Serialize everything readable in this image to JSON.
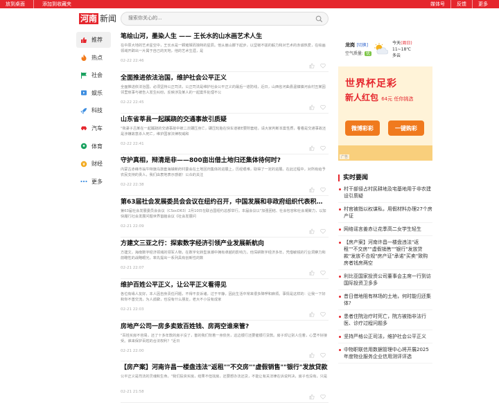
{
  "topbar": {
    "left": [
      "放到桌面",
      "添加到收藏夹"
    ],
    "right": [
      "媒体号",
      "反馈",
      "更多"
    ]
  },
  "header": {
    "logo_box": "河南",
    "logo_text": "新闻",
    "search_placeholder": "搜索你关心的..."
  },
  "nav": [
    {
      "label": "推荐",
      "icon": "thumb-up-icon",
      "color": "#e5262d",
      "active": true
    },
    {
      "label": "热点",
      "icon": "flame-icon",
      "color": "#f27a1a"
    },
    {
      "label": "社会",
      "icon": "flag-icon",
      "color": "#1aa260"
    },
    {
      "label": "娱乐",
      "icon": "film-icon",
      "color": "#3c8de0"
    },
    {
      "label": "科技",
      "icon": "rocket-icon",
      "color": "#3c8de0"
    },
    {
      "label": "汽车",
      "icon": "car-icon",
      "color": "#e5262d"
    },
    {
      "label": "体育",
      "icon": "soccer-icon",
      "color": "#1aa260"
    },
    {
      "label": "财经",
      "icon": "coin-icon",
      "color": "#f2a81a"
    },
    {
      "label": "更多",
      "icon": "more-dots-icon",
      "color": "#3c8de0"
    }
  ],
  "articles": [
    {
      "title": "笔绘山河，墨染人生 —— 王长水的山水画艺术人生",
      "summary": "在中原大地的艺术星空中，王长水是一颗璀璨而独特的星辰。他从嵩山脚下起步，以坚韧不拔的毅力和对艺术的赤诚热爱，在绘画领域开辟出一片属于自己的天地，他的艺术生涯，是",
      "date": "02-22 22:46"
    },
    {
      "title": "全面推进依法治国，维护社会公平正义",
      "summary": "全面推进依法治国，必须坚持公正司法，公正司法是维护社会公平正义的最后一道防线，近日，山西省河曲县温镇镇河会村丑某因邻里琐事与被告人发生纠纷，反映涉及某人的一起案件处理不公",
      "date": "02-22 22:45"
    },
    {
      "title": "山东省莘县一起蹊跷的交通事故引质疑",
      "summary": "\"我妻子吕某在一起蹊跷的交通事故中被二次碾压身亡，碾压轮胎在快车道被E要附套结，请大家判断本案性质，看看是交通事故还是涉嫌故意杀人死亡，维护国家法律权威和",
      "date": "02-22 22:41"
    },
    {
      "title": "守护真相，辩清是非——800亩出借土地归还集体待何时?",
      "summary": "内蒙古赤峰市翁牛特旗乌敦套海镇新府村委会在土地回归集体的进展上，历经艰难，取得了一定的进展。在此过程中，对所有给予农民支持的贵人，我们由衷地表示感谢！公众的关注",
      "date": "02-22 22:38"
    },
    {
      "title": "第63届社会发展委员会会议在纽约召开，中国发展和非政府组织代表积极参与",
      "summary": "第63届社会发展委员会会议（CSocD63）2月10日在联合国纽约总部举行。本届会议以\"加强团结、社会包容和社会凝聚力，以加快履行社会发展问题世界首脑会议《社会发展问",
      "date": "02-21 22:09"
    },
    {
      "title": "方建文三亚之行：探索数字经济引领产业发展新航向",
      "summary": "方建文，海南数字经济领域的领军人物，在数字化转型浪潮中拥有卓越的影响力。他深耕数字经济多年，凭借敏锐的行业洞察力和前瞻性的战略眼光，率先提出一系列具有创新性的数",
      "date": "02-21 22:07"
    },
    {
      "title": "维护百姓公平正义，让公平正义看得见",
      "summary": "各位有缘人友好，本人因自身责任问题，不得不去诉诸，过于平静，因此生活中常来很多降啰和麻烦。事情是这样的：让我一下好和你不善交流，为人孤僻，也没有什么朋友，老大不小没有成家",
      "date": "02-21 22:03"
    },
    {
      "title": "房地产公司一房多卖致百姓钱、房两空谁来管?",
      "summary": "\"百姓买房不容易，还了十多年款的房子没了，害的我们背着一身债务，这边银行还要催银行贷款。房子却让别人住着，心里不好接受。谁来保护百姓的合法权利？\"近日",
      "date": "02-21 22:00"
    },
    {
      "title": "【房产案】河南许昌一楼盘违法\"返租\"\"不交房\"\"虚假销售\"\"银行\"发放贷款",
      "summary": "公平正义是司法的灵魂和生命。\"我们投资买房，结果不但找房，还要想办法还贷，不能让有关法律在诉说判决，房子也没有，只是",
      "date": "02-21 21:58"
    }
  ],
  "weather": {
    "city": "龙岗",
    "switch": "[切换]",
    "aq_label": "空气质量:",
    "aq_value": "优",
    "today": "今天",
    "today_note": "(周日)",
    "temp": "11~18℃",
    "cond": "多云"
  },
  "ad": {
    "line1": "世界杯足彩",
    "line2": "新人红包",
    "line2_small": "64元 任你挑选",
    "btn1": "微博彩彩",
    "btn2": "一键购彩",
    "tag": "广告"
  },
  "hot": {
    "title": "实时要闻",
    "items": [
      "村干部侵占村民耕地及宅基地用于非农建设引质疑",
      "村官被指以权谋私，用假材料办理27个房产证",
      "网络谣言姜赤让花季高二女学生轻生",
      "【房产案】河南许昌一楼盘违法\"返租\"\"不交房\"\"虚假销售\"\"银行\"发放贷款\"发放不合规\"房产证\"承诺\"买卖\"致购房者钱房两空",
      "利比亚国家投资公司董事会主席一行到访国际投资卫多多",
      "昔日借地阻有林场的土地，何时能归还集体?",
      "患者住院治疗时死亡，院方被指非法行医、诊疗过程问题多",
      "坚持严格公正司法，维护社会公平正义",
      "中物职联信用数据管理中心将开展2025年度物业服务企业信用测评评选"
    ]
  }
}
